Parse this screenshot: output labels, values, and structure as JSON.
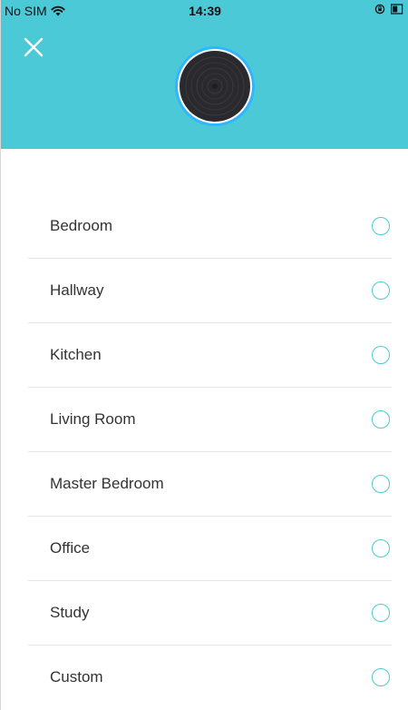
{
  "status_bar": {
    "carrier": "No SIM",
    "time": "14:39"
  },
  "header": {
    "close_icon": "close-icon",
    "device_icon": "speaker-icon",
    "background_color": "#4cc9d6"
  },
  "rooms": [
    {
      "label": "Bedroom",
      "selected": false
    },
    {
      "label": "Hallway",
      "selected": false
    },
    {
      "label": "Kitchen",
      "selected": false
    },
    {
      "label": "Living Room",
      "selected": false
    },
    {
      "label": "Master Bedroom",
      "selected": false
    },
    {
      "label": "Office",
      "selected": false
    },
    {
      "label": "Study",
      "selected": false
    },
    {
      "label": "Custom",
      "selected": false
    }
  ],
  "colors": {
    "accent": "#4cc9d6",
    "text": "#333333",
    "divider": "#e6e6e6"
  }
}
